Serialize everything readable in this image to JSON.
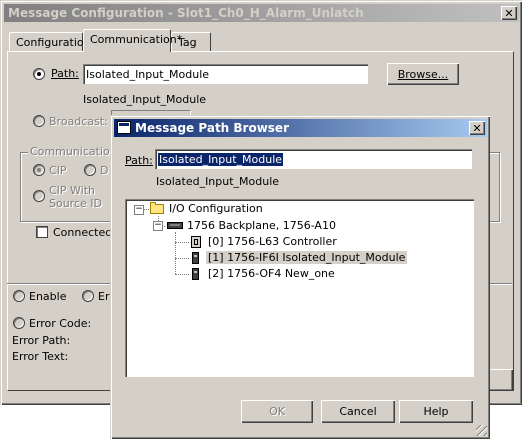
{
  "main_window": {
    "title": "Message Configuration - Slot1_Ch0_H_Alarm_Unlatch",
    "close_glyph": "✕",
    "tabs": [
      {
        "label": "Configuration"
      },
      {
        "label": "Communication*"
      },
      {
        "label": "Tag"
      }
    ],
    "path_label": "Path:",
    "path_value": "Isolated_Input_Module",
    "path_resolved": "Isolated_Input_Module",
    "browse_button": "Browse...",
    "broadcast_label": "Broadcast:",
    "comm_method_group": "Communication M",
    "cip_label": "CIP",
    "dh_label": "D",
    "cip_with_source_line1": "CIP With",
    "cip_with_source_line2": "Source ID",
    "connected_label": "Connected",
    "enable_label": "Enable",
    "enable_waiting_label": "Er",
    "error_code_label": "Error Code:",
    "error_path_label": "Error Path:",
    "error_text_label": "Error Text:"
  },
  "dialog": {
    "title": "Message Path Browser",
    "close_glyph": "✕",
    "path_label": "Path:",
    "path_value": "Isolated_Input_Module",
    "path_resolved": "Isolated_Input_Module",
    "tree": {
      "root": "I/O Configuration",
      "backplane": "1756 Backplane, 1756-A10",
      "modules": [
        {
          "label": "[0] 1756-L63 Controller",
          "selected": false
        },
        {
          "label": "[1] 1756-IF6I Isolated_Input_Module",
          "selected": true
        },
        {
          "label": "[2] 1756-OF4 New_one",
          "selected": false
        }
      ]
    },
    "ok_button": "OK",
    "cancel_button": "Cancel",
    "help_button": "Help"
  },
  "colors": {
    "face": "#d4d0c8",
    "active_title_start": "#0a246a",
    "active_title_end": "#a6caf0",
    "selection": "#0a246a",
    "tree_selection": "#d4d0c8"
  }
}
